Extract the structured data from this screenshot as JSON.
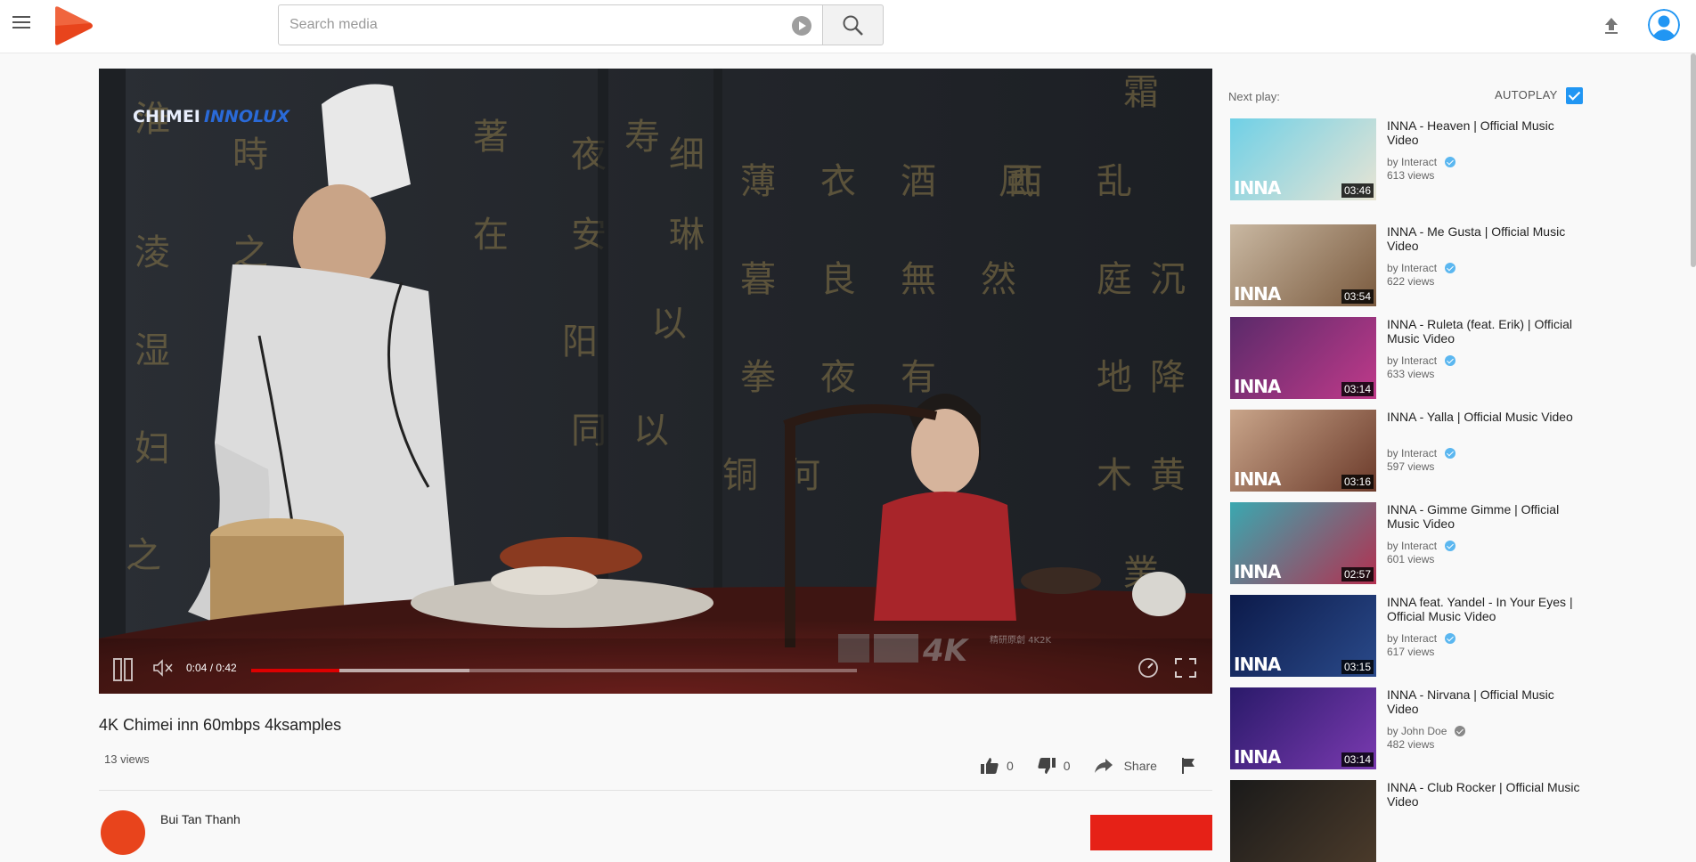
{
  "header": {
    "search_placeholder": "Search media",
    "accent": "#e8441c"
  },
  "player": {
    "time_display": "0:04 / 0:42",
    "progress_fraction": 0.145,
    "buffer_fraction": 0.36,
    "watermark_brand": "CHIMEI",
    "watermark_brand2": "INNOLUX"
  },
  "video": {
    "title": "4K Chimei inn 60mbps 4ksamples",
    "views": "13 views",
    "likes": "0",
    "dislikes": "0",
    "share_label": "Share",
    "channel_name": "Bui Tan Thanh"
  },
  "sidebar": {
    "next_play_label": "Next play:",
    "autoplay_label": "AUTOPLAY",
    "autoplay_on": true,
    "items": [
      {
        "title": "INNA - Heaven | Official Music Video",
        "channel": "by Interact",
        "views": "613 views",
        "duration": "03:46",
        "verified": "blue",
        "brand": "INNA",
        "thumb_colors": [
          "#6fd0e6",
          "#e8e4d4"
        ]
      },
      {
        "title": "INNA - Me Gusta | Official Music Video",
        "channel": "by Interact",
        "views": "622 views",
        "duration": "03:54",
        "verified": "blue",
        "brand": "INNA",
        "thumb_colors": [
          "#c9b8a2",
          "#7a5a3e"
        ]
      },
      {
        "title": "INNA - Ruleta (feat. Erik) | Official Music Video",
        "channel": "by Interact",
        "views": "633 views",
        "duration": "03:14",
        "verified": "blue",
        "brand": "INNA",
        "thumb_colors": [
          "#5a2a6a",
          "#c03a8a"
        ]
      },
      {
        "title": "INNA - Yalla | Official Music Video",
        "channel": "by Interact",
        "views": "597 views",
        "duration": "03:16",
        "verified": "blue",
        "brand": "INNA",
        "thumb_colors": [
          "#c9a58a",
          "#6b3a2a"
        ]
      },
      {
        "title": "INNA - Gimme Gimme | Official Music Video",
        "channel": "by Interact",
        "views": "601 views",
        "duration": "02:57",
        "verified": "blue",
        "brand": "INNA",
        "thumb_colors": [
          "#3aa8b0",
          "#b33050"
        ]
      },
      {
        "title": "INNA feat. Yandel - In Your Eyes | Official Music Video",
        "channel": "by Interact",
        "views": "617 views",
        "duration": "03:15",
        "verified": "blue",
        "brand": "INNA",
        "thumb_colors": [
          "#0c1a4a",
          "#2a4a8a"
        ]
      },
      {
        "title": "INNA - Nirvana | Official Music Video",
        "channel": "by John Doe",
        "views": "482 views",
        "duration": "03:14",
        "verified": "grey",
        "brand": "INNA",
        "thumb_colors": [
          "#2a1a6a",
          "#7a3ab0"
        ]
      },
      {
        "title": "INNA - Club Rocker | Official Music Video",
        "channel": "",
        "views": "",
        "duration": "",
        "verified": "",
        "brand": "",
        "thumb_colors": [
          "#1a1a1a",
          "#4a3a2a"
        ]
      }
    ]
  }
}
